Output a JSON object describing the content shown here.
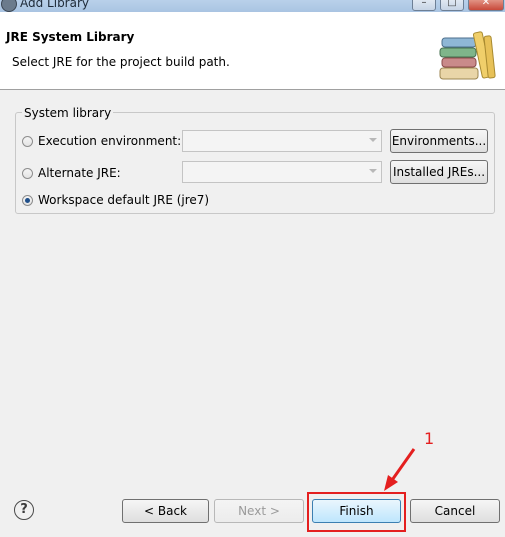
{
  "window": {
    "title": "Add Library",
    "controls": [
      "–",
      "□",
      "✕"
    ]
  },
  "header": {
    "title": "JRE System Library",
    "subtitle": "Select JRE for the project build path.",
    "icon": "library-books-icon"
  },
  "system_library": {
    "group_label": "System library",
    "options": [
      {
        "label": "Execution environment:",
        "checked": false,
        "combo_value": "",
        "button_label": "Environments..."
      },
      {
        "label": "Alternate JRE:",
        "checked": false,
        "combo_value": "",
        "button_label": "Installed JREs..."
      },
      {
        "label": "Workspace default JRE (jre7)",
        "checked": true
      }
    ]
  },
  "footer": {
    "help_icon": "help-icon",
    "help_glyph": "?",
    "back_label": "< Back",
    "next_label": "Next >",
    "finish_label": "Finish",
    "cancel_label": "Cancel"
  },
  "annotation": {
    "number": "1",
    "color": "#e41f1f"
  }
}
